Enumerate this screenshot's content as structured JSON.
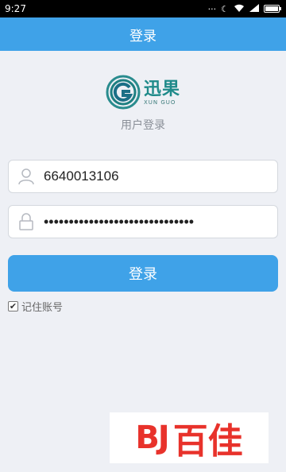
{
  "status_bar": {
    "time": "9:27",
    "icons": [
      "dots-icon",
      "moon-icon",
      "wifi-icon",
      "signal-icon",
      "battery-icon"
    ]
  },
  "title_bar": {
    "title": "登录"
  },
  "logo": {
    "cn": "迅果",
    "en": "XUN GUO"
  },
  "subtitle": "用户登录",
  "form": {
    "username": {
      "value": "6640013106",
      "icon": "user-icon"
    },
    "password": {
      "value": "••••••••••••••••••••••••••••••",
      "icon": "lock-icon"
    },
    "login_label": "登录",
    "remember": {
      "label": "记住账号",
      "checked": true
    }
  },
  "watermark": {
    "mark": "BJ",
    "text": "百佳"
  },
  "colors": {
    "accent": "#3fa2e8",
    "logo": "#1f8a8a",
    "watermark": "#e8322b"
  }
}
